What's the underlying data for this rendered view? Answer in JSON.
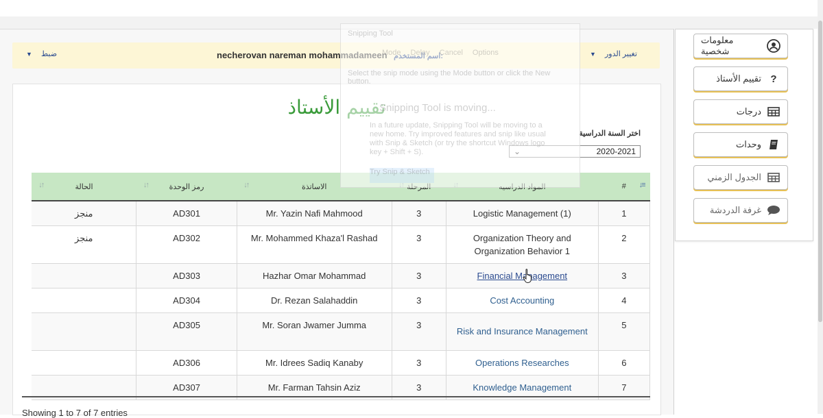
{
  "header": {
    "settings_label": "ضبط",
    "username_label": "اسم المستخدم:",
    "username": "necherovan nareman mohammadameen",
    "role_change_label": "تغيير الدور"
  },
  "sidebar": {
    "items": [
      {
        "label": "معلومات شخصية",
        "icon": "user-circle-icon"
      },
      {
        "label": "تقييم الأستاذ",
        "icon": "question-icon"
      },
      {
        "label": "درجات",
        "icon": "table-icon"
      },
      {
        "label": "وحدات",
        "icon": "book-icon"
      },
      {
        "label": "الجدول الزمني",
        "icon": "table-icon"
      },
      {
        "label": "غرفة الدردشة",
        "icon": "chat-icon"
      }
    ]
  },
  "page": {
    "title": "تقييم الأستاذ",
    "year_label": "اختر السنة الدراسية",
    "year_value": "2020-2021"
  },
  "table": {
    "columns": {
      "num": "#",
      "subject": "المواد الدراسيه",
      "stage": "المرحلة",
      "teacher": "الاساتذة",
      "unit_code": "رمز الوحدة",
      "status": "الحالة"
    },
    "rows": [
      {
        "num": "1",
        "subject": "Logistic Management (1)",
        "stage": "3",
        "teacher": "Mr. Yazin Nafi Mahmood",
        "unit_code": "AD301",
        "status": "منجز"
      },
      {
        "num": "2",
        "subject": "Organization Theory and Organization Behavior 1",
        "stage": "3",
        "teacher": "Mr. Mohammed Khaza'l Rashad",
        "unit_code": "AD302",
        "status": "منجز"
      },
      {
        "num": "3",
        "subject": "Financial Management",
        "stage": "3",
        "teacher": "Hazhar Omar Mohammad",
        "unit_code": "AD303",
        "status": ""
      },
      {
        "num": "4",
        "subject": "Cost Accounting",
        "stage": "3",
        "teacher": "Dr. Rezan Salahaddin",
        "unit_code": "AD304",
        "status": ""
      },
      {
        "num": "5",
        "subject": "Risk and Insurance Management",
        "stage": "3",
        "teacher": "Mr. Soran Jwamer Jumma",
        "unit_code": "AD305",
        "status": ""
      },
      {
        "num": "6",
        "subject": "Operations Researches",
        "stage": "3",
        "teacher": "Mr. Idrees Sadiq Kanaby",
        "unit_code": "AD306",
        "status": ""
      },
      {
        "num": "7",
        "subject": "Knowledge Management",
        "stage": "3",
        "teacher": "Mr. Farman Tahsin Aziz",
        "unit_code": "AD307",
        "status": ""
      }
    ],
    "footer": "Showing 1 to 7 of 7 entries"
  },
  "snipping_overlay": {
    "title": "Snipping Tool",
    "toolbar": [
      "Mode",
      "Delay",
      "Cancel",
      "Options"
    ],
    "hint": "Select the snip mode using the Mode button or click the New button.",
    "moving": "Snipping Tool is moving...",
    "text": "In a future update, Snipping Tool will be moving to a new home. Try improved features and snip like usual with Snip & Sketch (or try the shortcut Windows logo key + Shift + S).",
    "button": "Try Snip & Sketch"
  }
}
